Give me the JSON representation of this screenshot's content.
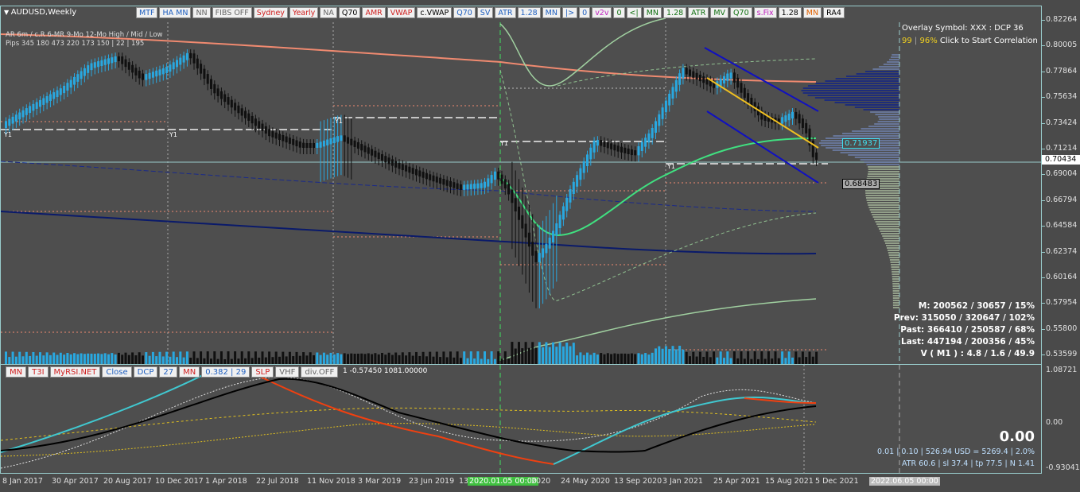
{
  "chart": {
    "symbol_title": "AUDUSD,Weekly",
    "overlay_symbol_text": "Overlay Symbol: XXX : DCP 36",
    "correlation_pct1": "99",
    "correlation_pct2": "96%",
    "correlation_action": "Click to Start Correlation",
    "current_price": "0.70434",
    "level_label_1": "0.71937",
    "level_label_2": "0.68483"
  },
  "toolbar_top": [
    {
      "label": "MTF",
      "color": "blue"
    },
    {
      "label": "HA MN",
      "color": "blue"
    },
    {
      "label": "NN",
      "color": "gray"
    },
    {
      "label": "FIBS OFF",
      "color": "gray"
    },
    {
      "label": "Sydney",
      "color": "red"
    },
    {
      "label": "Yearly",
      "color": "red"
    },
    {
      "label": "NA",
      "color": "gray"
    },
    {
      "label": "Q70",
      "color": "black"
    },
    {
      "label": "AMR",
      "color": "red"
    },
    {
      "label": "VWAP",
      "color": "red"
    },
    {
      "label": "c.VWAP",
      "color": "black"
    },
    {
      "label": "Q70",
      "color": "blue"
    },
    {
      "label": "SV",
      "color": "blue"
    },
    {
      "label": "ATR",
      "color": "blue"
    },
    {
      "label": "1.28",
      "color": "blue"
    },
    {
      "label": "MN",
      "color": "blue"
    },
    {
      "label": "|>",
      "color": "blue"
    },
    {
      "label": "0",
      "color": "blue"
    },
    {
      "label": "v2v",
      "color": "mag"
    },
    {
      "label": "0",
      "color": "green"
    },
    {
      "label": "<|",
      "color": "green"
    },
    {
      "label": "MN",
      "color": "green"
    },
    {
      "label": "1.28",
      "color": "green"
    },
    {
      "label": "ATR",
      "color": "green"
    },
    {
      "label": "MV",
      "color": "green"
    },
    {
      "label": "Q70",
      "color": "green"
    },
    {
      "label": "s.Fix",
      "color": "mag"
    },
    {
      "label": "1.28",
      "color": "black"
    },
    {
      "label": "MN",
      "color": "orange"
    },
    {
      "label": "RA4",
      "color": "black"
    }
  ],
  "toolbar_sub": [
    {
      "label": "MN",
      "color": "red"
    },
    {
      "label": "T3I",
      "color": "red"
    },
    {
      "label": "MyRSI.NET",
      "color": "red"
    },
    {
      "label": "Close",
      "color": "blue"
    },
    {
      "label": "DCP",
      "color": "blue"
    },
    {
      "label": "27",
      "color": "blue"
    },
    {
      "label": "MN",
      "color": "red"
    },
    {
      "label": "0.382 | 29",
      "color": "blue"
    },
    {
      "label": "SLP",
      "color": "red"
    },
    {
      "label": "VHF",
      "color": "gray"
    },
    {
      "label": "div.OFF",
      "color": "gray"
    }
  ],
  "sub_info": "1 -0.57450 1081.00000",
  "range_table": {
    "header": "AR   6m / c.R     6-MR    9-Mo    12-Mo      High / Mid / Low",
    "row": "Pips   345   180     473    220     173          150 | 22 | 195"
  },
  "stats": {
    "line1": "M: 200562 / 30657 / 15%",
    "line2": "Prev: 315050 / 320647 / 102%",
    "line3": "Past: 366410 / 250587 / 68%",
    "line4": "Last: 447194 / 200356 / 45%",
    "line5": "V ( M1 ) : 4.8 / 1.6 / 49.9"
  },
  "sub_stats": {
    "big_value": "0.00",
    "line1": "0.01  |  0.10  |  526.94 USD = 5269.4  |  2.0%",
    "line2": "ATR 60.6  | sl 37.4  |  tp 77.5  |  N 1.41"
  },
  "price_axis": [
    "0.82264",
    "0.80005",
    "0.77864",
    "0.75634",
    "0.73424",
    "0.71214",
    "0.69004",
    "0.66794",
    "0.64584",
    "0.62374",
    "0.60164",
    "0.57954",
    "0.55800",
    "0.53599"
  ],
  "sub_axis": [
    "1.08721",
    "0.00",
    "-0.93041"
  ],
  "time_axis": [
    "8 Jan 2017",
    "30 Apr 2017",
    "20 Aug 2017",
    "10 Dec 2017",
    "1 Apr 2018",
    "22 Jul 2018",
    "11 Nov 2018",
    "3 Mar 2019",
    "23 Jun 2019",
    "13",
    "2020.01.05 00:00",
    "2020",
    "24 May 2020",
    "13 Sep 2020",
    "3 Jan 2021",
    "25 Apr 2021",
    "15 Aug 2021",
    "5 Dec 2021",
    "2022.06.05 00:00"
  ],
  "year_markers": [
    "Y1",
    "Y1",
    "Y1",
    "Y1",
    "Y1"
  ],
  "colors": {
    "background": "#4e4e4e",
    "bull": "#29a8e0",
    "bear": "#101010",
    "salmon": "#f08a70",
    "navy": "#0a1a6a",
    "green_line": "#40e080",
    "channel": "#1010c0",
    "regression": "#f0c020"
  }
}
